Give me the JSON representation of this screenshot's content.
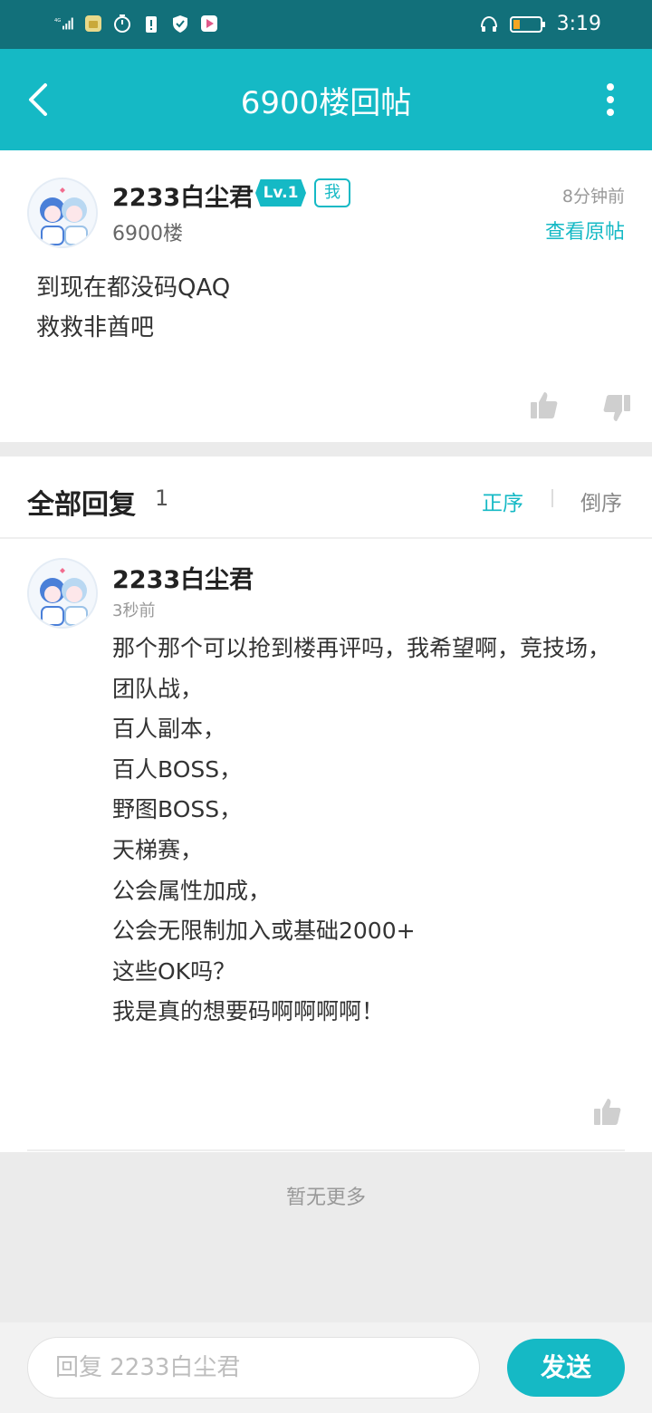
{
  "status_bar": {
    "network": "4G",
    "time": "3:19",
    "icons": [
      "signal-icon",
      "app-notification-icon",
      "timer-icon",
      "battery-alert-icon",
      "shield-icon",
      "app-icon",
      "headphones-icon",
      "battery-icon"
    ],
    "battery_color": "#f5a623"
  },
  "header": {
    "title": "6900楼回帖",
    "back_icon": "back-arrow-icon",
    "more_icon": "more-vertical-icon",
    "color": "#15b9c5"
  },
  "post": {
    "username": "2233白尘君",
    "level": "Lv.1",
    "me_badge": "我",
    "floor": "6900楼",
    "time": "8分钟前",
    "view_original": "查看原帖",
    "lines": [
      "到现在都没码QAQ",
      "救救非酋吧"
    ]
  },
  "replies": {
    "title": "全部回复",
    "count": "1",
    "sort_asc": "正序",
    "sort_desc": "倒序",
    "items": [
      {
        "username": "2233白尘君",
        "time": "3秒前",
        "text": "那个那个可以抢到楼再评吗，我希望啊，竞技场，\n团队战，\n百人副本，\n百人BOSS，\n野图BOSS，\n天梯赛，\n公会属性加成，\n公会无限制加入或基础2000+\n这些OK吗？\n我是真的想要码啊啊啊啊！"
      }
    ],
    "no_more": "暂无更多"
  },
  "footer": {
    "input_placeholder": "回复 2233白尘君",
    "send_label": "发送"
  }
}
